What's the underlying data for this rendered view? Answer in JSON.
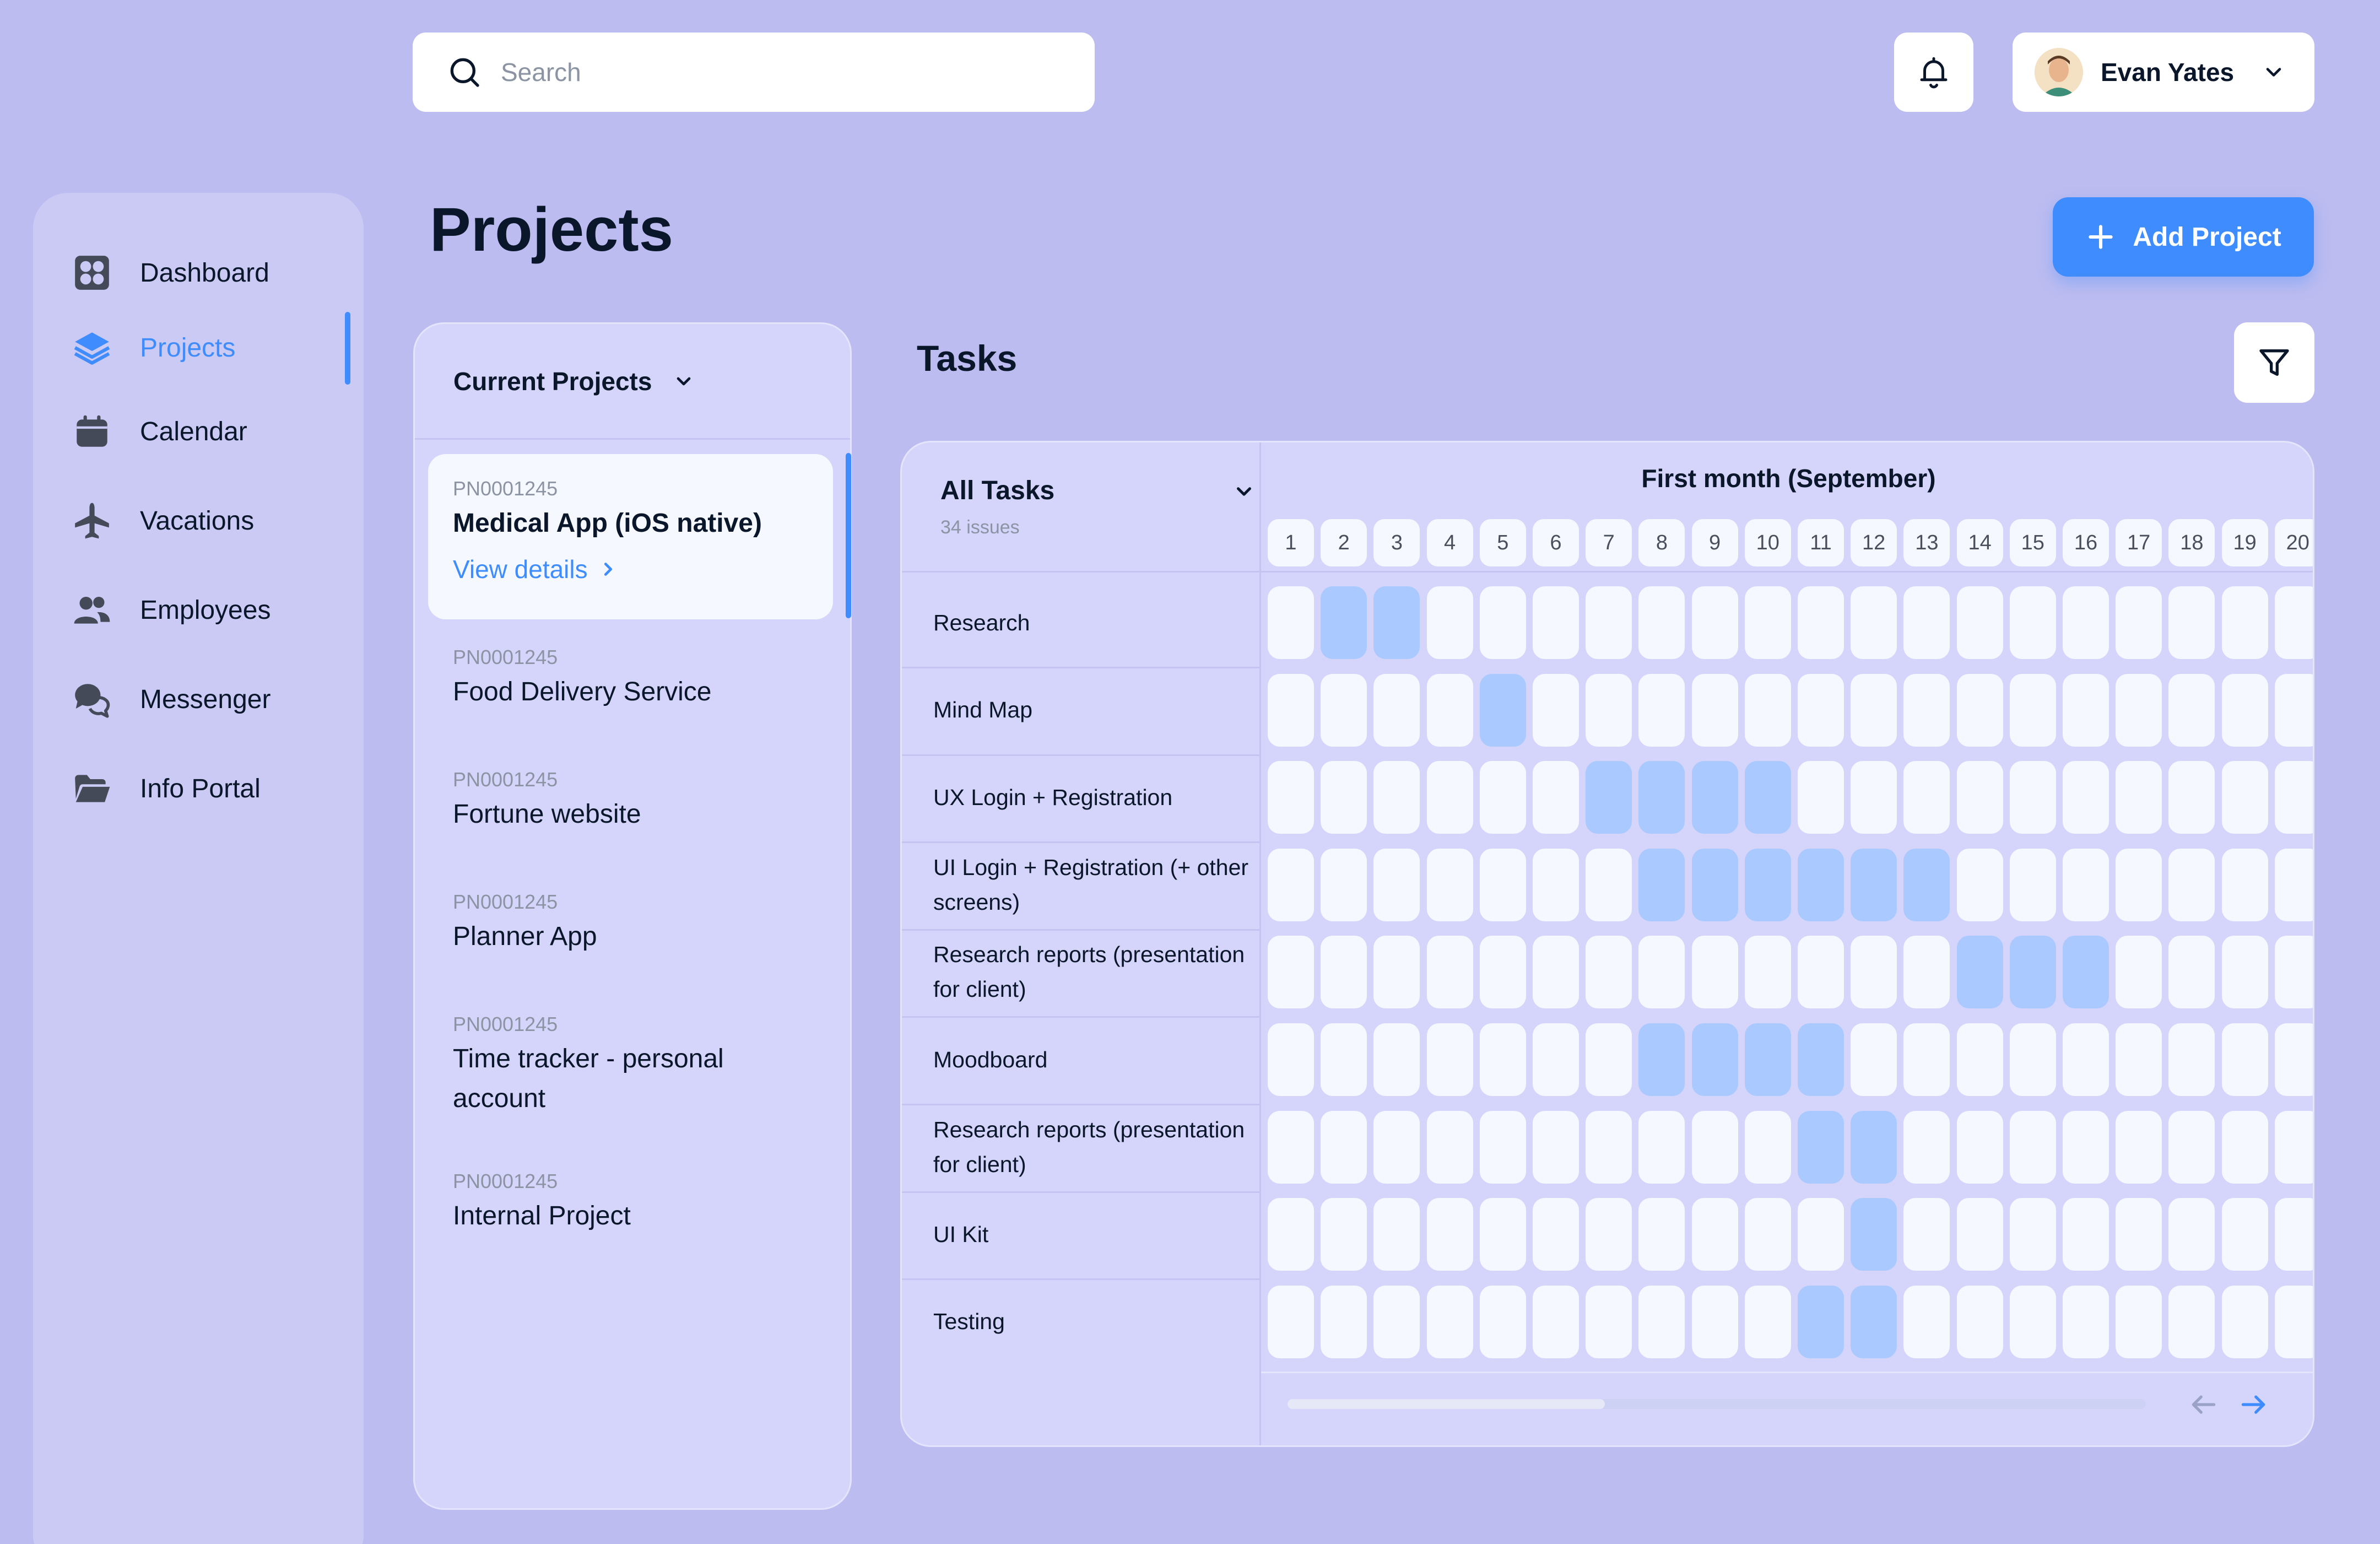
{
  "search": {
    "placeholder": "Search"
  },
  "user": {
    "name": "Evan Yates"
  },
  "sidebar": {
    "items": [
      {
        "label": "Dashboard",
        "icon": "dashboard-icon"
      },
      {
        "label": "Projects",
        "icon": "layers-icon",
        "active": true
      },
      {
        "label": "Calendar",
        "icon": "calendar-icon"
      },
      {
        "label": "Vacations",
        "icon": "airplane-icon"
      },
      {
        "label": "Employees",
        "icon": "people-icon"
      },
      {
        "label": "Messenger",
        "icon": "chat-icon"
      },
      {
        "label": "Info Portal",
        "icon": "folder-icon"
      }
    ]
  },
  "page": {
    "title": "Projects",
    "add_label": "Add Project"
  },
  "projects": {
    "header": "Current Projects",
    "view_details": "View details",
    "items": [
      {
        "code": "PN0001245",
        "name": "Medical App (iOS native)",
        "selected": true
      },
      {
        "code": "PN0001245",
        "name": "Food Delivery Service"
      },
      {
        "code": "PN0001245",
        "name": "Fortune website"
      },
      {
        "code": "PN0001245",
        "name": "Planner App"
      },
      {
        "code": "PN0001245",
        "name": "Time tracker - personal account"
      },
      {
        "code": "PN0001245",
        "name": "Internal Project"
      }
    ]
  },
  "tasks": {
    "title": "Tasks",
    "filter_label": "All Tasks",
    "issues": "34 issues",
    "month_label": "First month (September)",
    "days": [
      "1",
      "2",
      "3",
      "4",
      "5",
      "6",
      "7",
      "8",
      "9",
      "10",
      "11",
      "12",
      "13",
      "14",
      "15",
      "16",
      "17",
      "18",
      "19",
      "20"
    ],
    "rows": [
      {
        "name": "Research",
        "active_days": [
          2,
          3
        ]
      },
      {
        "name": "Mind Map",
        "active_days": [
          5
        ]
      },
      {
        "name": "UX Login + Registration",
        "active_days": [
          7,
          8,
          9,
          10
        ]
      },
      {
        "name": "UI Login + Registration (+ other screens)",
        "active_days": [
          8,
          9,
          10,
          11,
          12,
          13
        ]
      },
      {
        "name": "Research reports (presentation for client)",
        "active_days": [
          14,
          15,
          16
        ]
      },
      {
        "name": "Moodboard",
        "active_days": [
          8,
          9,
          10,
          11
        ]
      },
      {
        "name": "Research reports (presentation for client)",
        "active_days": [
          11,
          12
        ]
      },
      {
        "name": "UI Kit",
        "active_days": [
          12
        ]
      },
      {
        "name": "Testing",
        "active_days": [
          11,
          12
        ]
      }
    ]
  },
  "colors": {
    "background": "#bcbcf0",
    "accent": "#3f8cff",
    "active_cell": "#a9c9ff",
    "empty_cell": "#f5f8ff"
  }
}
